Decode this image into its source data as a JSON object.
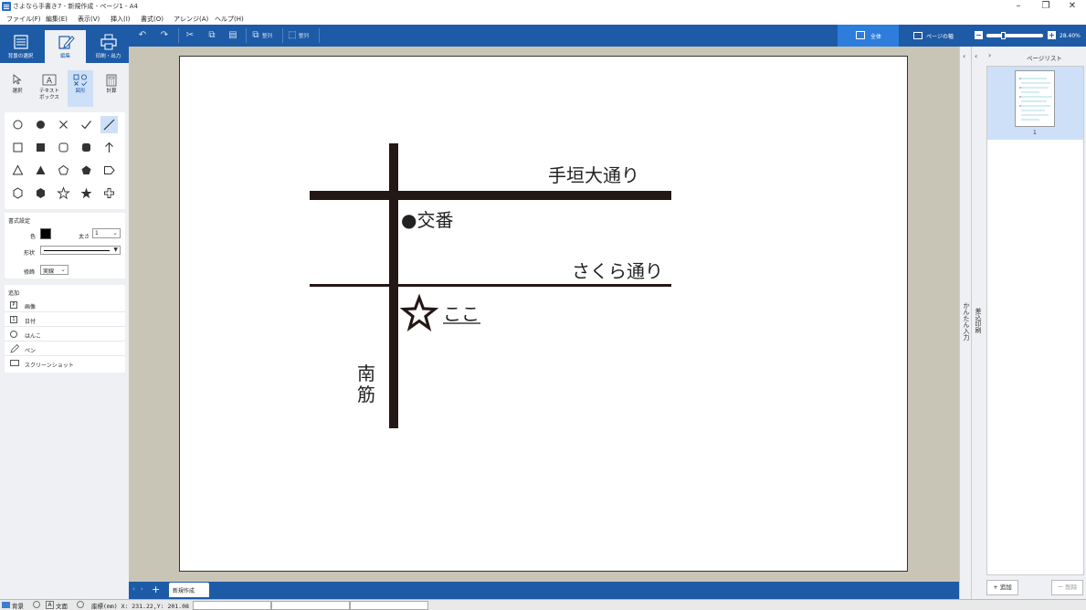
{
  "window": {
    "title": "さよなら手書き7 - 新規作成 - ページ1 - A4",
    "minimize": "–",
    "restore": "❐",
    "close": "✕"
  },
  "menu": [
    "ファイル(F)",
    "編集(E)",
    "表示(V)",
    "挿入(I)",
    "書式(O)",
    "アレンジ(A)",
    "ヘルプ(H)"
  ],
  "toolbar": {
    "arrange_label": "整列",
    "align_label": "整列",
    "view_all_label": "全体",
    "page_width_label": "ページの幅",
    "zoom_level": "28.40%",
    "zoom_fraction": 0.28
  },
  "left_tabs": {
    "background": "背景の選択",
    "edit": "編集",
    "print": "印刷・出力"
  },
  "tools": {
    "select": "選択",
    "textbox": "テキスト\nボックス",
    "shape": "図形",
    "calc": "計算"
  },
  "format": {
    "heading": "書式設定",
    "color_label": "色",
    "thickness_label": "太さ",
    "thickness_value": "1",
    "shape_label": "形状",
    "decoration_label": "修飾",
    "decoration_value": "実線"
  },
  "add": {
    "heading": "追加",
    "items": [
      {
        "icon": "image-icon",
        "label": "画像"
      },
      {
        "icon": "date-icon",
        "label": "日付"
      },
      {
        "icon": "stamp-icon",
        "label": "はんこ"
      },
      {
        "icon": "pen-icon",
        "label": "ペン"
      },
      {
        "icon": "screenshot-icon",
        "label": "スクリーンショット"
      }
    ]
  },
  "map": {
    "road_top": "手垣大通り",
    "police": "●交番",
    "road_middle": "さくら通り",
    "here": "ここ",
    "street_south_1": "南",
    "street_south_2": "筋"
  },
  "sheet": {
    "add_sheet": "+",
    "tab_label": "新規作成"
  },
  "side": {
    "easy_input": "かんたん入力",
    "merge_print": "差込印刷"
  },
  "page_list": {
    "title": "ページリスト",
    "page_number": "1",
    "add_button": "+ 追加",
    "delete_button": "ー 削除"
  },
  "status": {
    "background_label": "背景",
    "text_label": "文面",
    "coords": "座標(mm) X: 231.22,Y: 201.08"
  }
}
